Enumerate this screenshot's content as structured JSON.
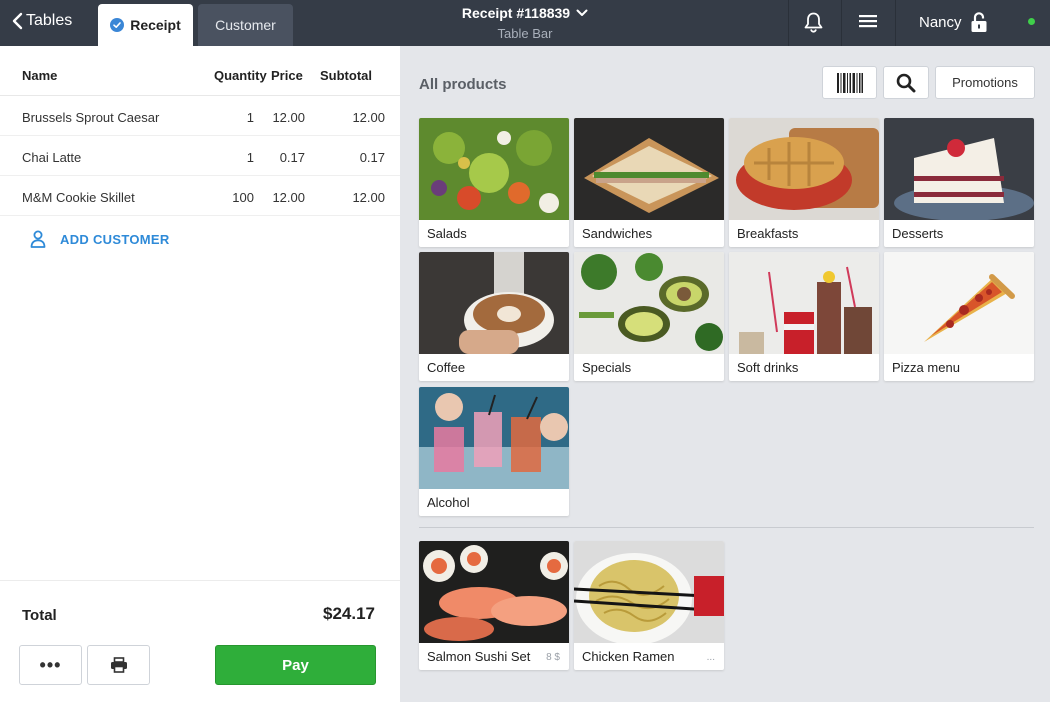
{
  "topbar": {
    "back_label": "Tables",
    "tabs": [
      {
        "label": "Receipt",
        "active": true
      },
      {
        "label": "Customer",
        "active": false
      }
    ],
    "receipt_number": "Receipt #118839",
    "table_name": "Table Bar",
    "user_name": "Nancy",
    "status_color": "#3fcf4a"
  },
  "receipt": {
    "columns": {
      "name": "Name",
      "quantity": "Quantity",
      "price": "Price",
      "subtotal": "Subtotal"
    },
    "items": [
      {
        "name": "Brussels Sprout Caesar",
        "quantity": "1",
        "price": "12.00",
        "subtotal": "12.00"
      },
      {
        "name": "Chai Latte",
        "quantity": "1",
        "price": "0.17",
        "subtotal": "0.17"
      },
      {
        "name": "M&M Cookie Skillet",
        "quantity": "100",
        "price": "12.00",
        "subtotal": "12.00"
      }
    ],
    "add_customer_label": "ADD CUSTOMER",
    "total_label": "Total",
    "total_value": "$24.17",
    "more_label": "•••",
    "pay_label": "Pay"
  },
  "products": {
    "section_title": "All products",
    "promotions_label": "Promotions",
    "categories": [
      {
        "label": "Salads",
        "icon": "salad-photo"
      },
      {
        "label": "Sandwiches",
        "icon": "sandwich-photo"
      },
      {
        "label": "Breakfasts",
        "icon": "waffle-photo"
      },
      {
        "label": "Desserts",
        "icon": "cake-photo"
      },
      {
        "label": "Coffee",
        "icon": "latte-photo"
      },
      {
        "label": "Specials",
        "icon": "avocado-photo"
      },
      {
        "label": "Soft drinks",
        "icon": "cola-photo"
      },
      {
        "label": "Pizza menu",
        "icon": "pizza-photo"
      },
      {
        "label": "Alcohol",
        "icon": "cocktail-photo"
      }
    ],
    "items": [
      {
        "label": "Salmon Sushi Set",
        "meta": "8 $",
        "icon": "sushi-photo"
      },
      {
        "label": "Chicken Ramen",
        "meta": "...",
        "icon": "ramen-photo"
      }
    ]
  },
  "colors": {
    "topbar_bg": "#353c47",
    "accent_blue": "#2e8ad8",
    "pay_green": "#2fae3a",
    "products_bg": "#e4e6ea"
  }
}
